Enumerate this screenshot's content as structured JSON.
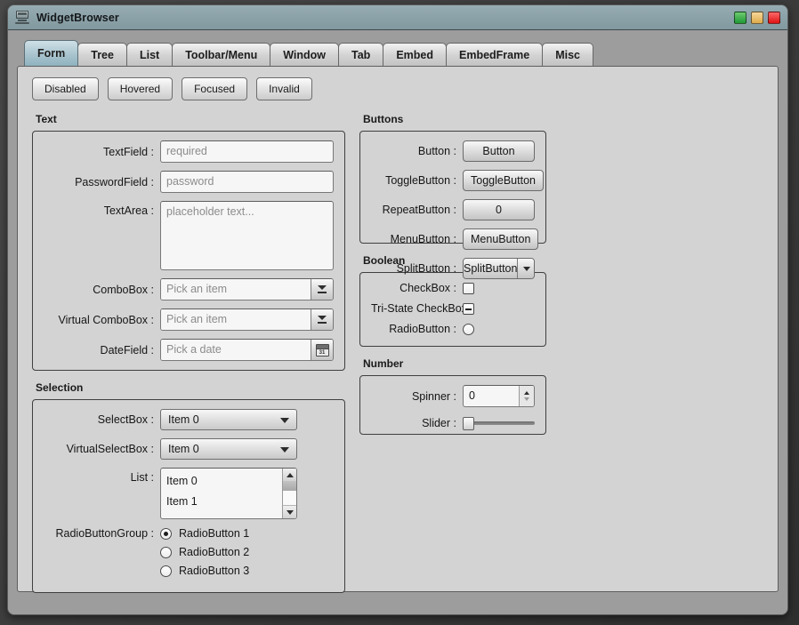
{
  "window": {
    "title": "WidgetBrowser",
    "icon": "computer-icon",
    "controls": {
      "minimize": "minimize-button",
      "maximize": "maximize-button",
      "close": "close-button"
    },
    "colors": {
      "titlebar": "#8ba1a8",
      "body": "#9d9d9d",
      "pane": "#d3d3d3",
      "active_tab": "#a9c4ce",
      "minimize": "#1f9a37",
      "maximize": "#e0ab4a",
      "close": "#e01212"
    }
  },
  "tabs": [
    {
      "label": "Form",
      "active": true
    },
    {
      "label": "Tree",
      "active": false
    },
    {
      "label": "List",
      "active": false
    },
    {
      "label": "Toolbar/Menu",
      "active": false
    },
    {
      "label": "Window",
      "active": false
    },
    {
      "label": "Tab",
      "active": false
    },
    {
      "label": "Embed",
      "active": false
    },
    {
      "label": "EmbedFrame",
      "active": false
    },
    {
      "label": "Misc",
      "active": false
    }
  ],
  "state_buttons": [
    {
      "label": "Disabled"
    },
    {
      "label": "Hovered"
    },
    {
      "label": "Focused"
    },
    {
      "label": "Invalid"
    }
  ],
  "groups": {
    "text": {
      "title": "Text",
      "textfield": {
        "label": "TextField :",
        "placeholder": "required"
      },
      "passwordfield": {
        "label": "PasswordField :",
        "placeholder": "password"
      },
      "textarea": {
        "label": "TextArea :",
        "placeholder": "placeholder text..."
      },
      "combobox": {
        "label": "ComboBox :",
        "placeholder": "Pick an item"
      },
      "virtual_combobox": {
        "label": "Virtual ComboBox :",
        "placeholder": "Pick an item"
      },
      "datefield": {
        "label": "DateField :",
        "placeholder": "Pick a date",
        "icon_text": "31"
      }
    },
    "selection": {
      "title": "Selection",
      "selectbox": {
        "label": "SelectBox :",
        "value": "Item 0"
      },
      "virtualselectbox": {
        "label": "VirtualSelectBox :",
        "value": "Item 0"
      },
      "list": {
        "label": "List :",
        "items": [
          "Item 0",
          "Item 1"
        ]
      },
      "radiogroup": {
        "label": "RadioButtonGroup :",
        "options": [
          {
            "label": "RadioButton 1",
            "selected": true
          },
          {
            "label": "RadioButton 2",
            "selected": false
          },
          {
            "label": "RadioButton 3",
            "selected": false
          }
        ]
      }
    },
    "buttons": {
      "title": "Buttons",
      "button": {
        "label": "Button :",
        "value": "Button"
      },
      "togglebutton": {
        "label": "ToggleButton :",
        "value": "ToggleButton"
      },
      "repeatbutton": {
        "label": "RepeatButton :",
        "value": "0"
      },
      "menubutton": {
        "label": "MenuButton :",
        "value": "MenuButton"
      },
      "splitbutton": {
        "label": "SplitButton :",
        "value": "SplitButton"
      }
    },
    "boolean": {
      "title": "Boolean",
      "checkbox": {
        "label": "CheckBox :",
        "state": "unchecked"
      },
      "tristate": {
        "label": "Tri-State CheckBox :",
        "state": "indeterminate"
      },
      "radiobutton": {
        "label": "RadioButton :",
        "state": "unchecked"
      }
    },
    "number": {
      "title": "Number",
      "spinner": {
        "label": "Spinner :",
        "value": "0"
      },
      "slider": {
        "label": "Slider :",
        "value": 0
      }
    }
  }
}
